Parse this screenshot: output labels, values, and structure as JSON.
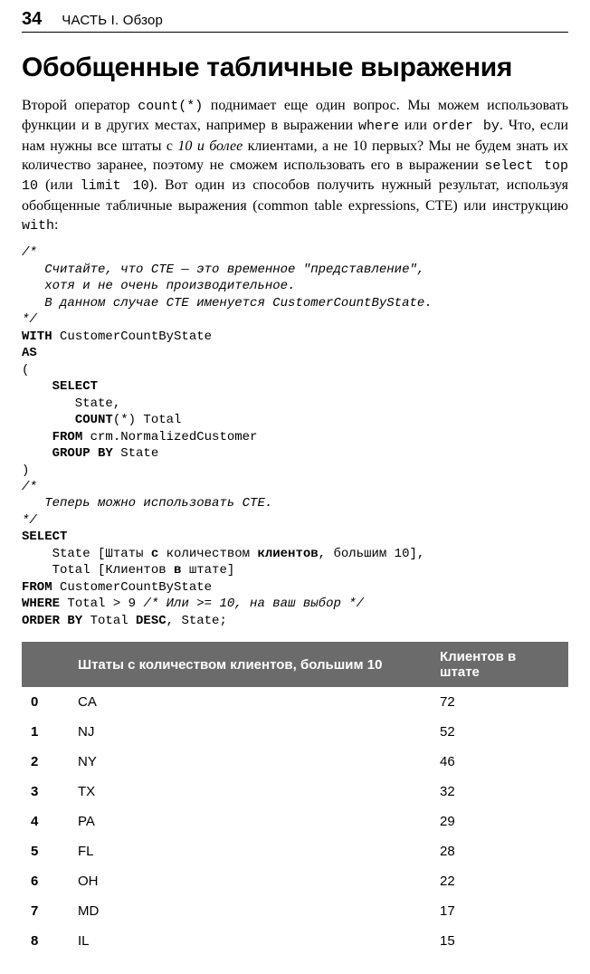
{
  "header": {
    "page_number": "34",
    "running_head": "ЧАСТЬ I. Обзор"
  },
  "title": "Обобщенные табличные выражения",
  "paragraph": {
    "p1_a": "Второй оператор ",
    "p1_code1": "count(*)",
    "p1_b": " поднимает еще один вопрос. Мы можем использовать функции и в других местах, например в выражении ",
    "p1_code2": "where",
    "p1_c": " или ",
    "p1_code3": "order by",
    "p1_d": ". Что, если нам нужны все штаты с ",
    "p1_em": "10 и более",
    "p1_e": " клиентами, а не 10 первых? Мы не будем знать их количество заранее, поэтому не сможем использовать его в выражении ",
    "p1_code4": "select top 10",
    "p1_f": " (или ",
    "p1_code5": "limit 10",
    "p1_g": "). Вот один из способов получить нужный результат, используя обобщенные табличные выражения (common table expressions, CTE) или инструкцию ",
    "p1_code6": "with",
    "p1_h": ":"
  },
  "code": {
    "c01": "/*",
    "c02": "   Считайте, что CTE — это временное \"представление\",",
    "c03": "   хотя и не очень производительное.",
    "c04": "   В данном случае CTE именуется CustomerCountByState.",
    "c05": "*/",
    "c06a": "WITH",
    "c06b": " CustomerCountByState",
    "c07": "AS",
    "c08": "(",
    "c09": "    SELECT",
    "c10": "       State,",
    "c11a": "       ",
    "c11b": "COUNT",
    "c11c": "(*) Total",
    "c12a": "    ",
    "c12b": "FROM",
    "c12c": " crm.NormalizedCustomer",
    "c13a": "    ",
    "c13b": "GROUP BY",
    "c13c": " State",
    "c14": ")",
    "c15": "/*",
    "c16": "   Теперь можно использовать CTE.",
    "c17": "*/",
    "c18": "SELECT",
    "c19a": "    State [Штаты ",
    "c19b": "с",
    "c19c": " количеством ",
    "c19d": "клиентов",
    "c19e": ", большим 10],",
    "c20a": "    Total [Клиентов ",
    "c20b": "в",
    "c20c": " штате]",
    "c21a": "FROM",
    "c21b": " CustomerCountByState",
    "c22a": "WHERE",
    "c22b": " Total > 9 ",
    "c22c": "/* Или >= 10, на ваш выбор */",
    "c23a": "ORDER BY",
    "c23b": " Total ",
    "c23c": "DESC",
    "c23d": ", State;"
  },
  "table": {
    "headers": {
      "idx": "",
      "col1": "Штаты с количеством клиентов, большим 10",
      "col2": "Клиентов в штате"
    },
    "rows": [
      {
        "idx": "0",
        "state": "CA",
        "count": "72"
      },
      {
        "idx": "1",
        "state": "NJ",
        "count": "52"
      },
      {
        "idx": "2",
        "state": "NY",
        "count": "46"
      },
      {
        "idx": "3",
        "state": "TX",
        "count": "32"
      },
      {
        "idx": "4",
        "state": "PA",
        "count": "29"
      },
      {
        "idx": "5",
        "state": "FL",
        "count": "28"
      },
      {
        "idx": "6",
        "state": "OH",
        "count": "22"
      },
      {
        "idx": "7",
        "state": "MD",
        "count": "17"
      },
      {
        "idx": "8",
        "state": "IL",
        "count": "15"
      }
    ]
  }
}
